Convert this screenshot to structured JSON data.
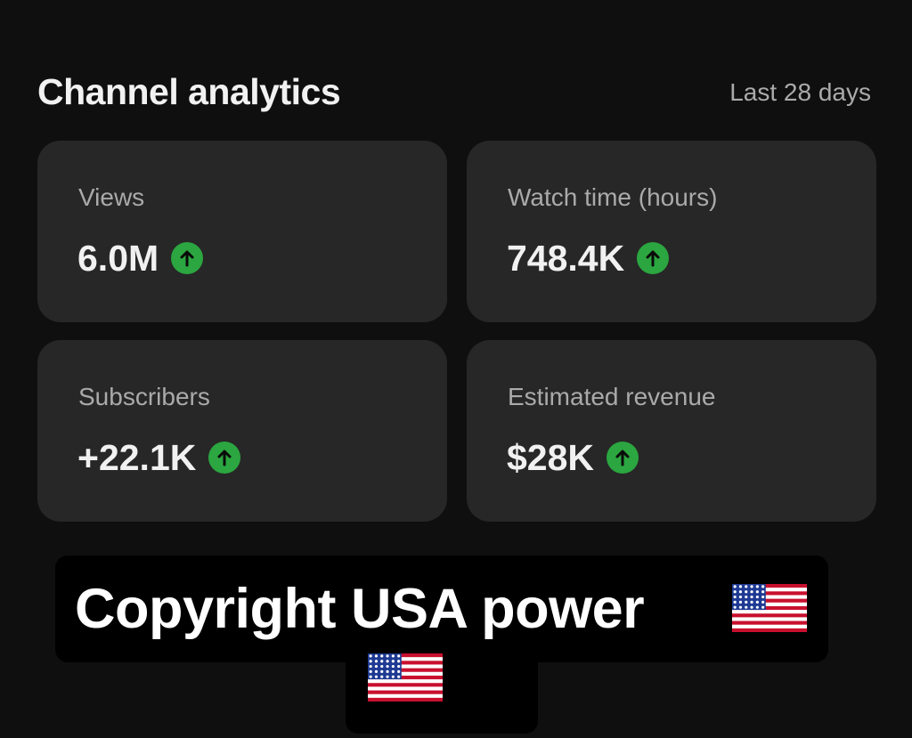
{
  "header": {
    "title": "Channel analytics",
    "period": "Last 28 days"
  },
  "metrics": [
    {
      "label": "Views",
      "value": "6.0M",
      "trend": "up"
    },
    {
      "label": "Watch time (hours)",
      "value": "748.4K",
      "trend": "up"
    },
    {
      "label": "Subscribers",
      "value": "+22.1K",
      "trend": "up"
    },
    {
      "label": "Estimated revenue",
      "value": "$28K",
      "trend": "up"
    }
  ],
  "caption": {
    "text": "Copyright USA power",
    "emoji": "us-flag-icon"
  },
  "colors": {
    "background": "#0f0f0f",
    "card": "#272727",
    "trend_up": "#2ba640",
    "label_text": "#aaaaaa"
  }
}
